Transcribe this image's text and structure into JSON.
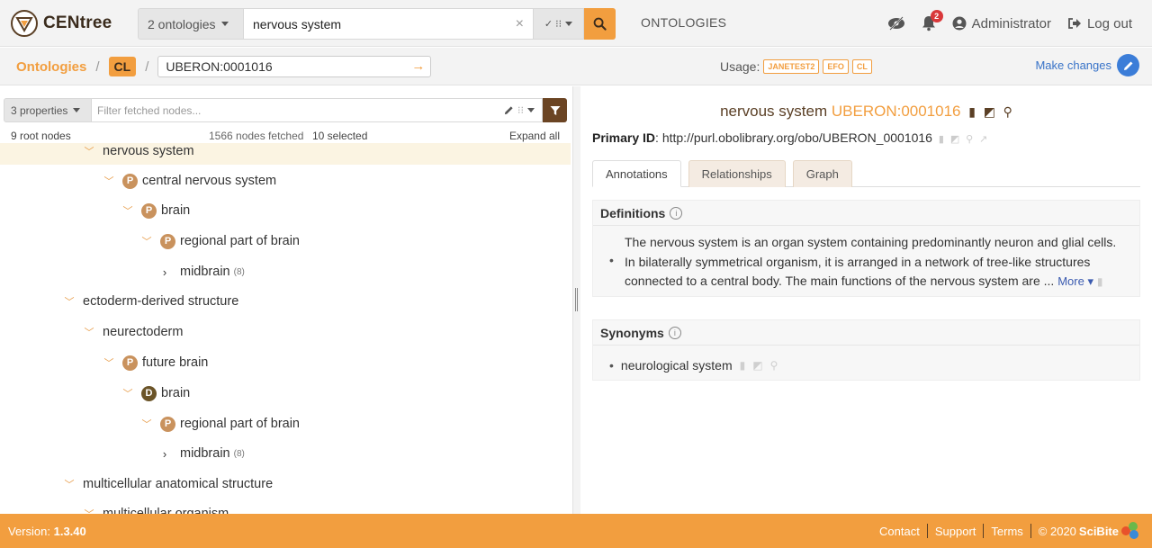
{
  "brand": {
    "name": "CENtree"
  },
  "search": {
    "ontology_select": "2 ontologies",
    "query": "nervous system",
    "clear": "×",
    "options": "✓ ⁝⁝"
  },
  "nav": {
    "ontologies": "ONTOLOGIES",
    "notifications_count": "2",
    "user": "Administrator",
    "logout": "Log out"
  },
  "breadcrumb": {
    "root": "Ontologies",
    "sep": "/",
    "ontology": "CL",
    "term_input": "UBERON:0001016"
  },
  "usage": {
    "label": "Usage:",
    "badges": [
      "JANETEST2",
      "EFO",
      "CL"
    ]
  },
  "make_changes": "Make changes",
  "tree_toolbar": {
    "properties_select": "3 properties",
    "filter_placeholder": "Filter fetched nodes..."
  },
  "tree_stats": {
    "roots": "9 root nodes",
    "fetched": "1566 nodes fetched",
    "selected": "10 selected",
    "expand_all": "Expand all"
  },
  "tree": [
    {
      "label": "nervous system",
      "badge": "",
      "chevron": "down",
      "count": "",
      "highlight": true
    },
    {
      "label": "central nervous system",
      "badge": "P",
      "chevron": "down",
      "count": ""
    },
    {
      "label": "brain",
      "badge": "P",
      "chevron": "down",
      "count": ""
    },
    {
      "label": "regional part of brain",
      "badge": "P",
      "chevron": "down",
      "count": ""
    },
    {
      "label": "midbrain",
      "badge": "",
      "chevron": "right",
      "count": "(8)"
    },
    {
      "label": "ectoderm-derived structure",
      "badge": "",
      "chevron": "down",
      "count": ""
    },
    {
      "label": "neurectoderm",
      "badge": "",
      "chevron": "down",
      "count": ""
    },
    {
      "label": "future brain",
      "badge": "P",
      "chevron": "down",
      "count": ""
    },
    {
      "label": "brain",
      "badge": "D",
      "chevron": "down",
      "count": ""
    },
    {
      "label": "regional part of brain",
      "badge": "P",
      "chevron": "down",
      "count": ""
    },
    {
      "label": "midbrain",
      "badge": "",
      "chevron": "right",
      "count": "(8)"
    },
    {
      "label": "multicellular anatomical structure",
      "badge": "",
      "chevron": "down",
      "count": ""
    },
    {
      "label": "multicellular organism",
      "badge": "",
      "chevron": "down",
      "count": ""
    }
  ],
  "term": {
    "name": "nervous system",
    "id": "UBERON:0001016",
    "primary_id_label": "Primary ID",
    "primary_id": "http://purl.obolibrary.org/obo/UBERON_0001016"
  },
  "tabs": [
    "Annotations",
    "Relationships",
    "Graph"
  ],
  "definitions": {
    "title": "Definitions",
    "line1": "The nervous system is an organ system containing predominantly neuron and glial cells.",
    "line2": "In bilaterally symmetrical organism, it is arranged in a network of tree-like structures",
    "line3": "connected to a central body. The main functions of the nervous system are ...",
    "more": "More"
  },
  "synonyms": {
    "title": "Synonyms",
    "items": [
      "neurological system"
    ]
  },
  "footer": {
    "version_label": "Version:",
    "version": "1.3.40",
    "links": [
      "Contact",
      "Support",
      "Terms"
    ],
    "copyright": "© 2020",
    "company": "SciBite"
  },
  "colors": {
    "accent": "#f29e3f",
    "brand_dark": "#5a3f25",
    "link_blue": "#3b7dd8"
  }
}
